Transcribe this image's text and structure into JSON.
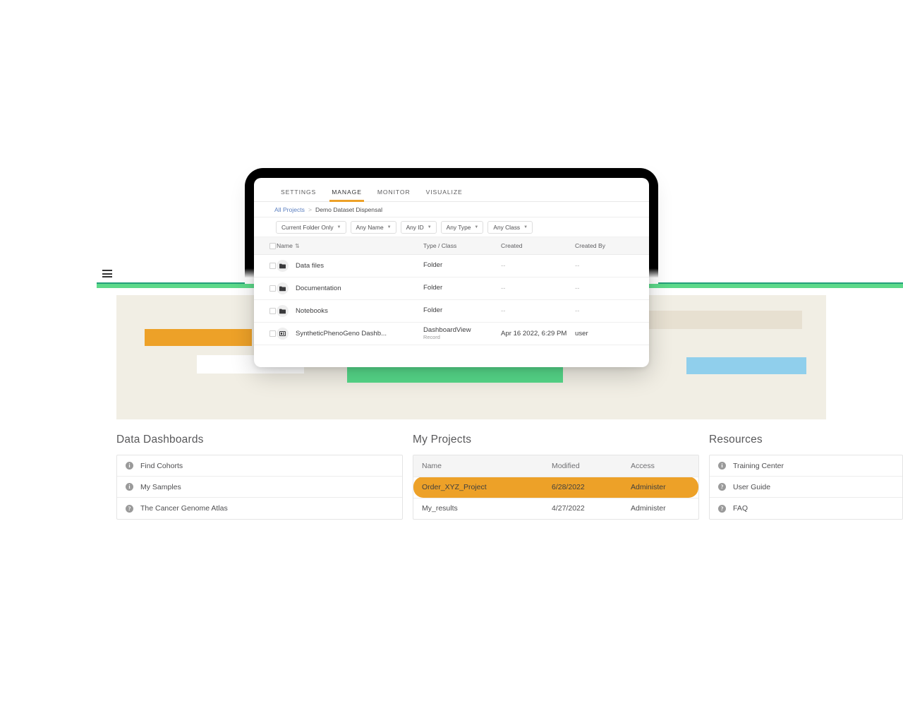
{
  "colors": {
    "accent_orange": "#eda128",
    "green_bar": "#5cd98a",
    "green_bar_top": "#24a07a",
    "banner_bg": "#f1eee4",
    "block_blue": "#90cfec",
    "block_green": "#56d98a",
    "block_beige": "#e7e0d1",
    "link_blue": "#5b7fc0"
  },
  "topbar": {
    "menu_icon": "hamburger-menu-icon"
  },
  "banner": {
    "blocks": [
      {
        "name": "orange-placeholder-block",
        "color": "#eda128"
      },
      {
        "name": "white-placeholder-block",
        "color": "#ffffff"
      },
      {
        "name": "beige-placeholder-block",
        "color": "#e7e0d1"
      },
      {
        "name": "green-placeholder-block",
        "color": "#56d98a"
      },
      {
        "name": "blue-placeholder-block",
        "color": "#90cfec"
      }
    ]
  },
  "dashboards_card": {
    "title": "Data Dashboards",
    "items": [
      {
        "icon": "info-circle-icon",
        "glyph": "i",
        "label": "Find Cohorts"
      },
      {
        "icon": "info-circle-icon",
        "glyph": "i",
        "label": "My Samples"
      },
      {
        "icon": "help-circle-icon",
        "glyph": "?",
        "label": "The Cancer Genome Atlas"
      }
    ]
  },
  "projects_card": {
    "title": "My Projects",
    "columns": [
      "Name",
      "Modified",
      "Access"
    ],
    "rows": [
      {
        "name": "Order_XYZ_Project",
        "modified": "6/28/2022",
        "access": "Administer",
        "selected": true
      },
      {
        "name": "My_results",
        "modified": "4/27/2022",
        "access": "Administer",
        "selected": false
      }
    ]
  },
  "resources_card": {
    "title": "Resources",
    "items": [
      {
        "icon": "info-circle-icon",
        "glyph": "i",
        "label": "Training Center"
      },
      {
        "icon": "help-circle-icon",
        "glyph": "?",
        "label": "User Guide"
      },
      {
        "icon": "help-circle-icon",
        "glyph": "?",
        "label": "FAQ"
      }
    ]
  },
  "overlay": {
    "tabs": [
      {
        "label": "SETTINGS",
        "active": false
      },
      {
        "label": "MANAGE",
        "active": true
      },
      {
        "label": "MONITOR",
        "active": false
      },
      {
        "label": "VISUALIZE",
        "active": false
      }
    ],
    "breadcrumb": {
      "root": "All Projects",
      "separator": ">",
      "current": "Demo Dataset Dispensal"
    },
    "filters": [
      {
        "label": "Current Folder Only",
        "caret": "chevron-down-icon"
      },
      {
        "label": "Any Name",
        "caret": "chevron-down-icon"
      },
      {
        "label": "Any ID",
        "caret": "chevron-down-icon"
      },
      {
        "label": "Any Type",
        "caret": "chevron-down-icon"
      },
      {
        "label": "Any Class",
        "caret": "chevron-down-icon"
      }
    ],
    "columns": {
      "name": "Name",
      "sort_glyph": "⇅",
      "type_class": "Type / Class",
      "created": "Created",
      "created_by": "Created By"
    },
    "rows": [
      {
        "icon": "folder-icon",
        "name": "Data files",
        "type": "Folder",
        "subtype": "",
        "created": "--",
        "created_by": "--"
      },
      {
        "icon": "folder-icon",
        "name": "Documentation",
        "type": "Folder",
        "subtype": "",
        "created": "--",
        "created_by": "--"
      },
      {
        "icon": "folder-icon",
        "name": "Notebooks",
        "type": "Folder",
        "subtype": "",
        "created": "--",
        "created_by": "--"
      },
      {
        "icon": "dashboard-record-icon",
        "name": "SyntheticPhenoGeno Dashb...",
        "type": "DashboardView",
        "subtype": "Record",
        "created": "Apr 16 2022, 6:29 PM",
        "created_by": "user"
      }
    ]
  }
}
